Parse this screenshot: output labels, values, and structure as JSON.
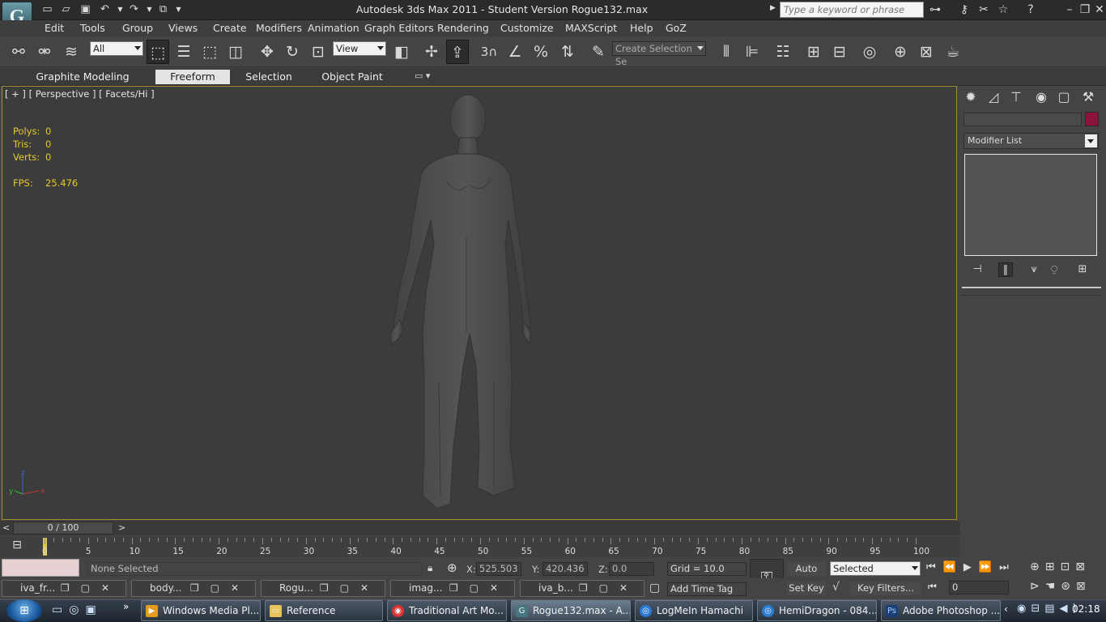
{
  "window": {
    "title": "Autodesk 3ds Max  2011   - Student Version    Rogue132.max",
    "search_placeholder": "Type a keyword or phrase"
  },
  "menu": [
    "Edit",
    "Tools",
    "Group",
    "Views",
    "Create",
    "Modifiers",
    "Animation",
    "Graph Editors",
    "Rendering",
    "Customize",
    "MAXScript",
    "Help",
    "GoZ"
  ],
  "toolbar": {
    "filter_value": "All",
    "coord_value": "View",
    "selection_set_placeholder": "Create Selection Se",
    "snap_value": "3"
  },
  "ribbon": {
    "tabs": [
      "Graphite Modeling Tools",
      "Freeform",
      "Selection",
      "Object Paint"
    ],
    "active": "Freeform"
  },
  "viewport": {
    "label": "[ + ] [ Perspective ] [ Facets/Hi ]",
    "stats": {
      "polys_label": "Polys:",
      "polys": "0",
      "tris_label": "Tris:",
      "tris": "0",
      "verts_label": "Verts:",
      "verts": "0",
      "fps_label": "FPS:",
      "fps": "25.476"
    },
    "axis": {
      "x": "x",
      "y": "y",
      "z": "z"
    }
  },
  "command_panel": {
    "modifier_list": "Modifier List",
    "object_color": "#8b1238"
  },
  "time_slider": {
    "position": "0 / 100",
    "prev": "<",
    "next": ">"
  },
  "timeline": {
    "ticks": [
      "0",
      "5",
      "10",
      "15",
      "20",
      "25",
      "30",
      "35",
      "40",
      "45",
      "50",
      "55",
      "60",
      "65",
      "70",
      "75",
      "80",
      "85",
      "90",
      "95",
      "100"
    ]
  },
  "status": {
    "selection": "None Selected",
    "x_label": "X:",
    "x": "525.503",
    "y_label": "Y:",
    "y": "420.436",
    "z_label": "Z:",
    "z": "0.0",
    "grid": "Grid = 10.0",
    "add_time_tag": "Add Time Tag",
    "auto_key": "Auto Key",
    "set_key": "Set Key",
    "selected": "Selected",
    "key_filters": "Key Filters...",
    "frame": "0"
  },
  "minimized_windows": [
    "iva_fr...",
    "body...",
    "Rogu...",
    "imag...",
    "iva_b..."
  ],
  "taskbar": {
    "buttons": [
      "Windows Media Pl...",
      "Reference",
      "Traditional Art Mo...",
      "Rogue132.max - A...",
      "LogMeIn Hamachi",
      "HemiDragon - 084...",
      "Adobe Photoshop ..."
    ],
    "clock": "02:18"
  }
}
